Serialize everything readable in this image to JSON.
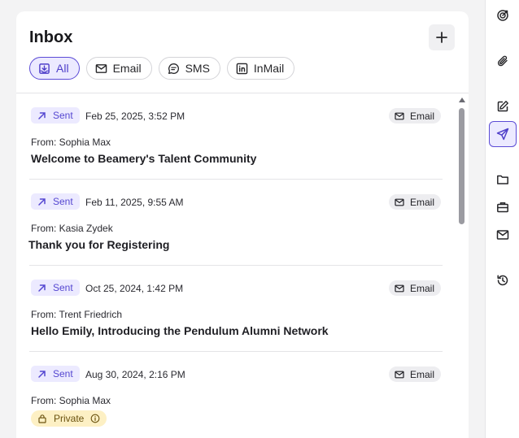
{
  "inbox": {
    "title": "Inbox",
    "filters": [
      {
        "label": "All",
        "icon": "inbox-download-icon",
        "active": true
      },
      {
        "label": "Email",
        "icon": "envelope-icon",
        "active": false
      },
      {
        "label": "SMS",
        "icon": "chat-bubble-icon",
        "active": false
      },
      {
        "label": "InMail",
        "icon": "linkedin-icon",
        "active": false
      }
    ],
    "messages": [
      {
        "status": "Sent",
        "date": "Feb 25, 2025, 3:52 PM",
        "type": "Email",
        "from": "From: Sophia Max",
        "subject": "Welcome to Beamery's Talent Community"
      },
      {
        "status": "Sent",
        "date": "Feb 11, 2025, 9:55 AM",
        "type": "Email",
        "from": "From: Kasia Zydek",
        "subject": "Thank you for Registering"
      },
      {
        "status": "Sent",
        "date": "Oct 25, 2024, 1:42 PM",
        "type": "Email",
        "from": "From: Trent Friedrich",
        "subject": "Hello Emily, Introducing the Pendulum Alumni Network"
      },
      {
        "status": "Sent",
        "date": "Aug 30, 2024, 2:16 PM",
        "type": "Email",
        "from": "From: Sophia Max",
        "private": "Private"
      }
    ]
  },
  "rail": {
    "items": [
      "target-icon",
      "paperclip-icon",
      "edit-note-icon",
      "send-icon",
      "folder-icon",
      "briefcase-icon",
      "envelope-icon",
      "history-icon"
    ],
    "active": "send-icon"
  },
  "colors": {
    "accent": "#5b4bd6",
    "accent_bg": "#eceaff",
    "private_bg": "#fdf0c4"
  }
}
